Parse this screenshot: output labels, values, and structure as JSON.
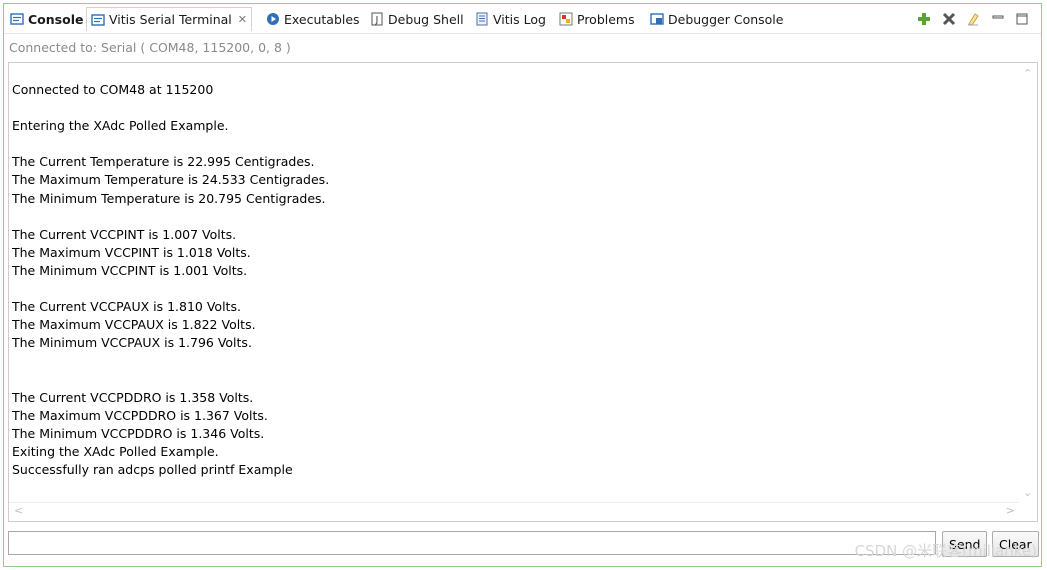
{
  "tabs": [
    {
      "label": "Console",
      "icon": "console-icon",
      "bold": true
    },
    {
      "label": "Vitis Serial Terminal",
      "icon": "terminal-icon",
      "active": true,
      "close": "✕"
    },
    {
      "label": "Executables",
      "icon": "executables-icon"
    },
    {
      "label": "Debug Shell",
      "icon": "debug-shell-icon"
    },
    {
      "label": "Vitis Log",
      "icon": "log-icon"
    },
    {
      "label": "Problems",
      "icon": "problems-icon"
    },
    {
      "label": "Debugger Console",
      "icon": "debugger-console-icon"
    }
  ],
  "toolbar": {
    "icons": [
      "add-icon",
      "remove-icon",
      "clear-console-icon",
      "minimize-icon",
      "maximize-icon"
    ]
  },
  "status": "Connected to: Serial ( COM48, 115200, 0, 8 )",
  "output_lines": [
    "Connected to COM48 at 115200",
    "",
    "Entering the XAdc Polled Example.",
    "",
    "The Current Temperature is 22.995 Centigrades.",
    "The Maximum Temperature is 24.533 Centigrades.",
    "The Minimum Temperature is 20.795 Centigrades.",
    "",
    "The Current VCCPINT is 1.007 Volts.",
    "The Maximum VCCPINT is 1.018 Volts.",
    "The Minimum VCCPINT is 1.001 Volts.",
    "",
    "The Current VCCPAUX is 1.810 Volts.",
    "The Maximum VCCPAUX is 1.822 Volts.",
    "The Minimum VCCPAUX is 1.796 Volts.",
    "",
    "",
    "The Current VCCPDDRO is 1.358 Volts.",
    "The Maximum VCCPDDRO is 1.367 Volts.",
    "The Minimum VCCPDDRO is 1.346 Volts.",
    "Exiting the XAdc Polled Example.",
    "Successfully ran adcps polled printf Example"
  ],
  "input": {
    "value": ""
  },
  "buttons": {
    "send": "Send",
    "clear": "Clear"
  },
  "watermark": "CSDN @米联客(milianke)",
  "colors": {
    "accent_green": "#8fce8f",
    "status_text": "#8a8a8a",
    "add_icon": "#5aa530"
  }
}
